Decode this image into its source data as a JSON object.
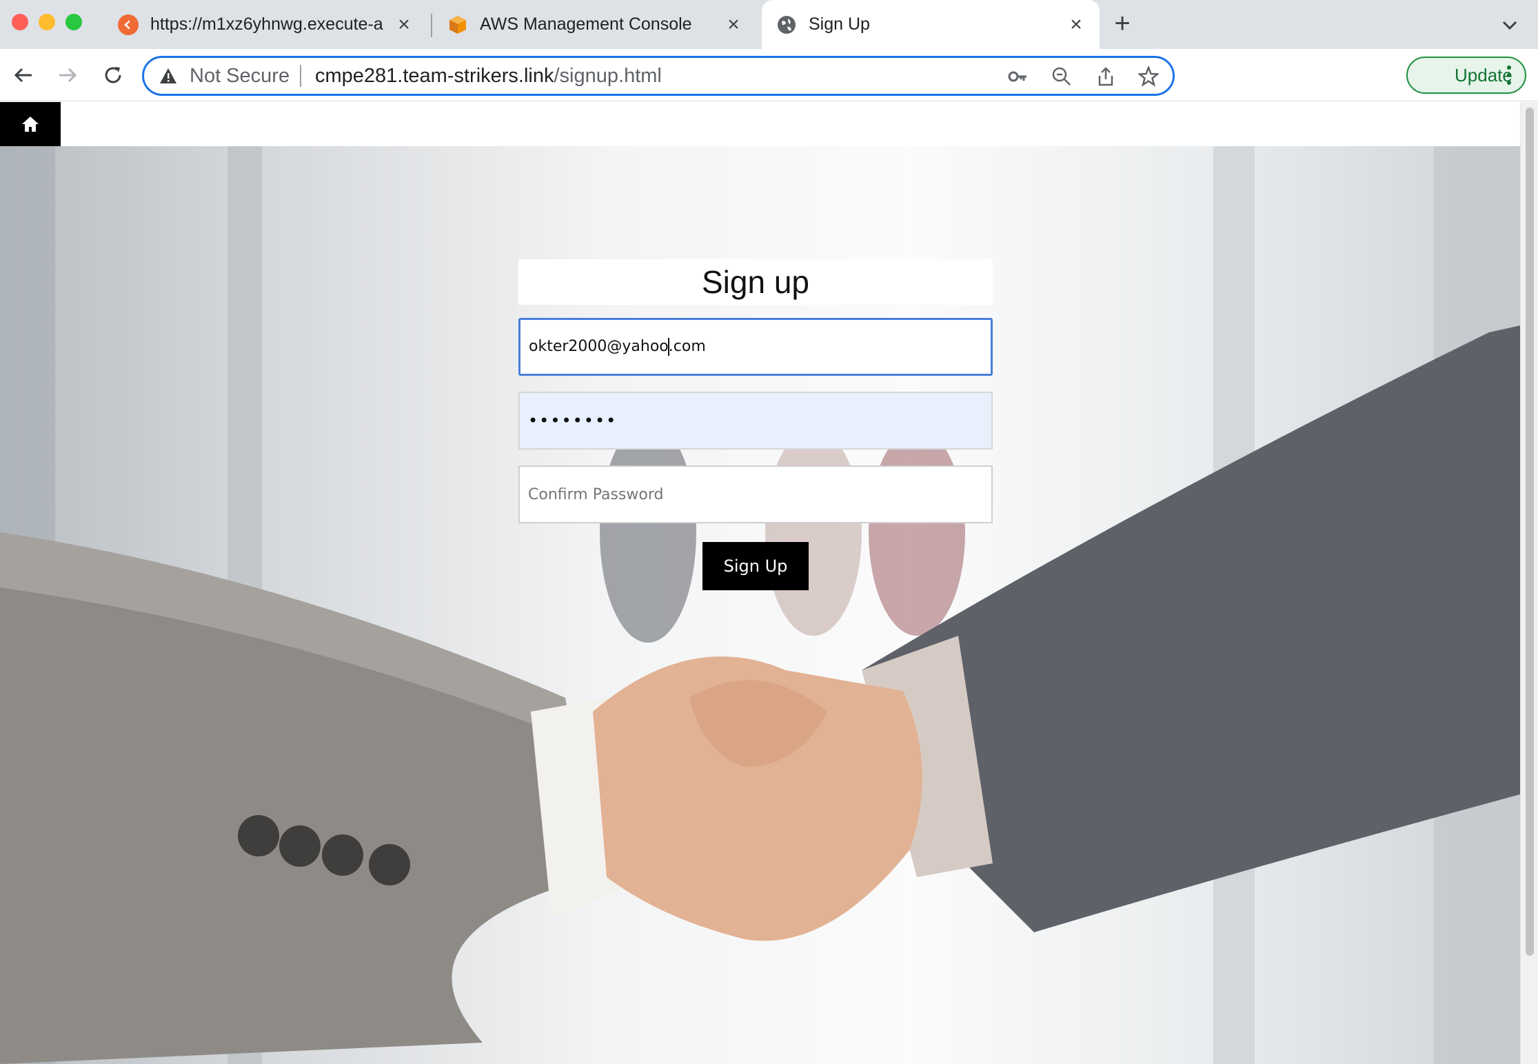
{
  "browser": {
    "tabs": [
      {
        "title": "https://m1xz6yhnwg.execute-a",
        "icon": "api-gateway-icon"
      },
      {
        "title": "AWS Management Console",
        "icon": "aws-cube-icon"
      },
      {
        "title": "Sign Up",
        "icon": "globe-icon",
        "active": true
      }
    ],
    "security_label": "Not Secure",
    "url_host": "cmpe281.team-strikers.link",
    "url_path": "/signup.html",
    "update_label": "Update"
  },
  "page": {
    "heading": "Sign up",
    "email_value_before_caret": "okter2000@yahoo",
    "email_value_after_caret": ".com",
    "password_mask": "••••••••",
    "confirm_placeholder": "Confirm Password",
    "submit_label": "Sign Up",
    "home_icon": "home-icon"
  },
  "colors": {
    "focus_ring": "#1a73e8",
    "update_green": "#1e8e3e",
    "autofill_bg": "#e8f0fe"
  }
}
